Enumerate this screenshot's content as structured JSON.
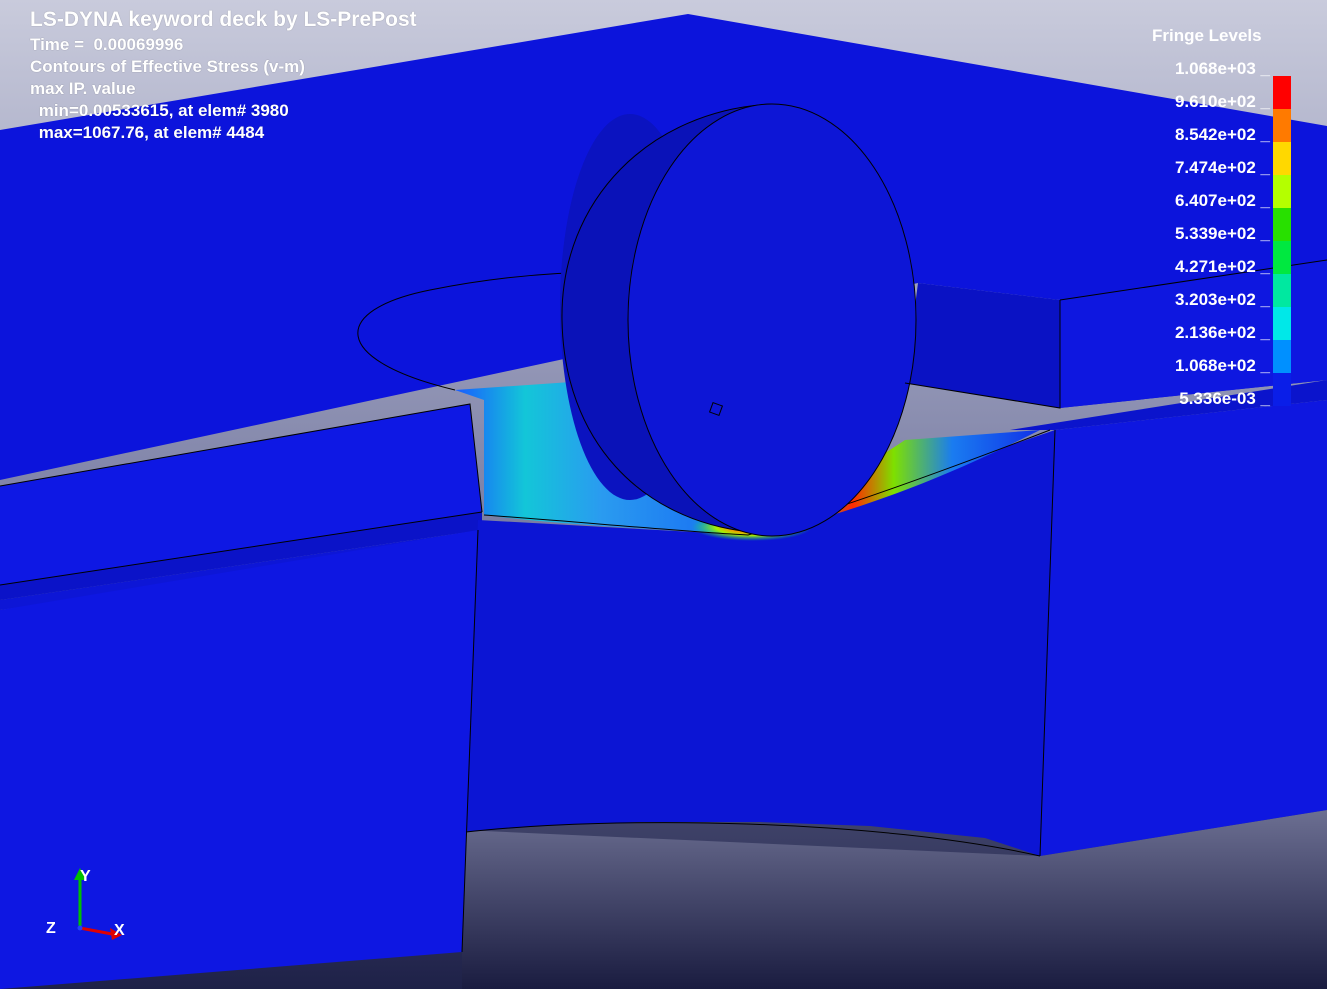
{
  "header": {
    "title": "LS-DYNA keyword deck by LS-PrePost",
    "time_line": "Time =  0.00069996",
    "contour_line": "Contours of Effective Stress (v-m)",
    "ip_line": "max IP. value",
    "min_line": " min=0.00533615, at elem# 3980",
    "max_line": " max=1067.76, at elem# 4484"
  },
  "legend": {
    "title": "Fringe Levels",
    "levels": [
      "1.068e+03",
      "9.610e+02",
      "8.542e+02",
      "7.474e+02",
      "6.407e+02",
      "5.339e+02",
      "4.271e+02",
      "3.203e+02",
      "2.136e+02",
      "1.068e+02",
      "5.336e-03"
    ],
    "colors": [
      "#ff0000",
      "#ff7a00",
      "#ffd800",
      "#b4ff00",
      "#28e000",
      "#00e840",
      "#00e8a0",
      "#00e8e8",
      "#0090ff",
      "#0a1ee8"
    ]
  },
  "axes": {
    "y": "Y",
    "z": "Z",
    "x": "X"
  },
  "colors": {
    "background_top": "#b7b9cf",
    "background_bottom": "#1e2148",
    "model_blue": "#0f17e0"
  }
}
